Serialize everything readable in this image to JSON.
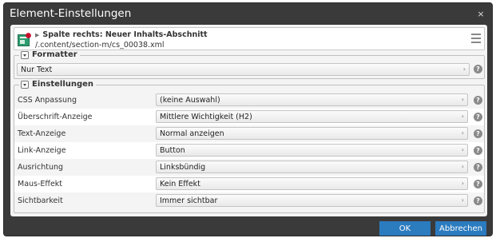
{
  "dialog": {
    "title": "Element-Einstellungen",
    "close_glyph": "×"
  },
  "resource": {
    "title": "Spalte rechts: Neuer Inhalts-Abschnitt",
    "path": "/.content/section-m/cs_00038.xml",
    "icon": "content-section-icon",
    "accent_color": "#c8102e"
  },
  "formatter": {
    "legend": "Formatter",
    "value": "Nur Text"
  },
  "settings": {
    "legend": "Einstellungen",
    "rows": [
      {
        "label": "CSS Anpassung",
        "value": "(keine Auswahl)"
      },
      {
        "label": "Überschrift-Anzeige",
        "value": "Mittlere Wichtigkeit (H2)"
      },
      {
        "label": "Text-Anzeige",
        "value": "Normal anzeigen"
      },
      {
        "label": "Link-Anzeige",
        "value": "Button"
      },
      {
        "label": "Ausrichtung",
        "value": "Linksbündig"
      },
      {
        "label": "Maus-Effekt",
        "value": "Kein Effekt"
      },
      {
        "label": "Sichtbarkeit",
        "value": "Immer sichtbar"
      }
    ]
  },
  "footer": {
    "ok_label": "OK",
    "cancel_label": "Abbrechen"
  },
  "help_glyph": "?",
  "select_arrow_glyph": "›",
  "colors": {
    "button": "#2b7bbf",
    "titlebar": "#3a3a3a"
  }
}
